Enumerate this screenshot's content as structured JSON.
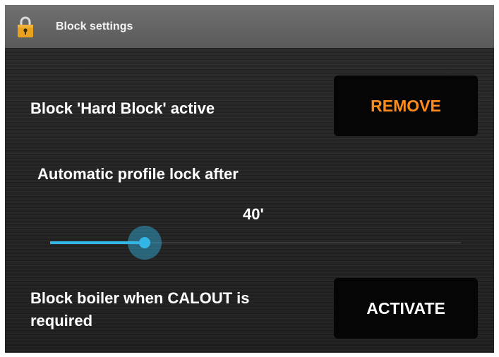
{
  "window": {
    "title": "Block settings",
    "icon": "lock-icon"
  },
  "block_row": {
    "label": "Block 'Hard Block' active",
    "button_label": "REMOVE",
    "button_color": "#ff8c1a"
  },
  "profile_lock": {
    "label": "Automatic profile lock after",
    "value_text": "40'",
    "slider_fraction": 0.23,
    "accent_color": "#33b5e5"
  },
  "boiler_row": {
    "label_line1": "Block boiler when CALOUT is",
    "label_line2": "required",
    "button_label": "ACTIVATE",
    "button_color": "#ffffff"
  }
}
